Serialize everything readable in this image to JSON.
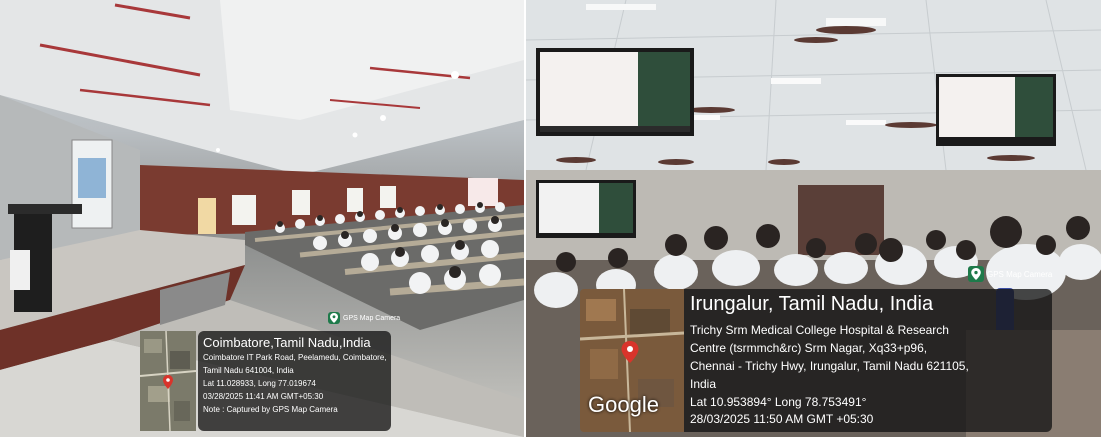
{
  "photo_left": {
    "badge": "GPS Map Camera",
    "place": "Coimbatore,Tamil Nadu,India",
    "address_lines": [
      "Coimbatore IT Park Road, Peelamedu, Coimbatore,",
      "Tamil Nadu 641004, India"
    ],
    "coords": "Lat 11.028933, Long 77.019674",
    "datetime": "03/28/2025 11:41 AM GMT+05:30",
    "note": "Note : Captured by GPS Map Camera"
  },
  "photo_right": {
    "badge": "GPS Map Camera",
    "place": "Irungalur, Tamil Nadu, India",
    "address_lines": [
      "Trichy Srm Medical College Hospital & Research",
      "Centre (tsrmmch&rc) Srm Nagar, Xq33+p96,",
      "Chennai - Trichy Hwy, Irungalur, Tamil Nadu 621105,",
      "India"
    ],
    "coords": "Lat 10.953894° Long 78.753491°",
    "datetime": "28/03/2025 11:50 AM GMT +05:30",
    "map_logo": "Google"
  },
  "colors": {
    "pin": "#d9342b",
    "badge_green": "#1e7a4a"
  }
}
